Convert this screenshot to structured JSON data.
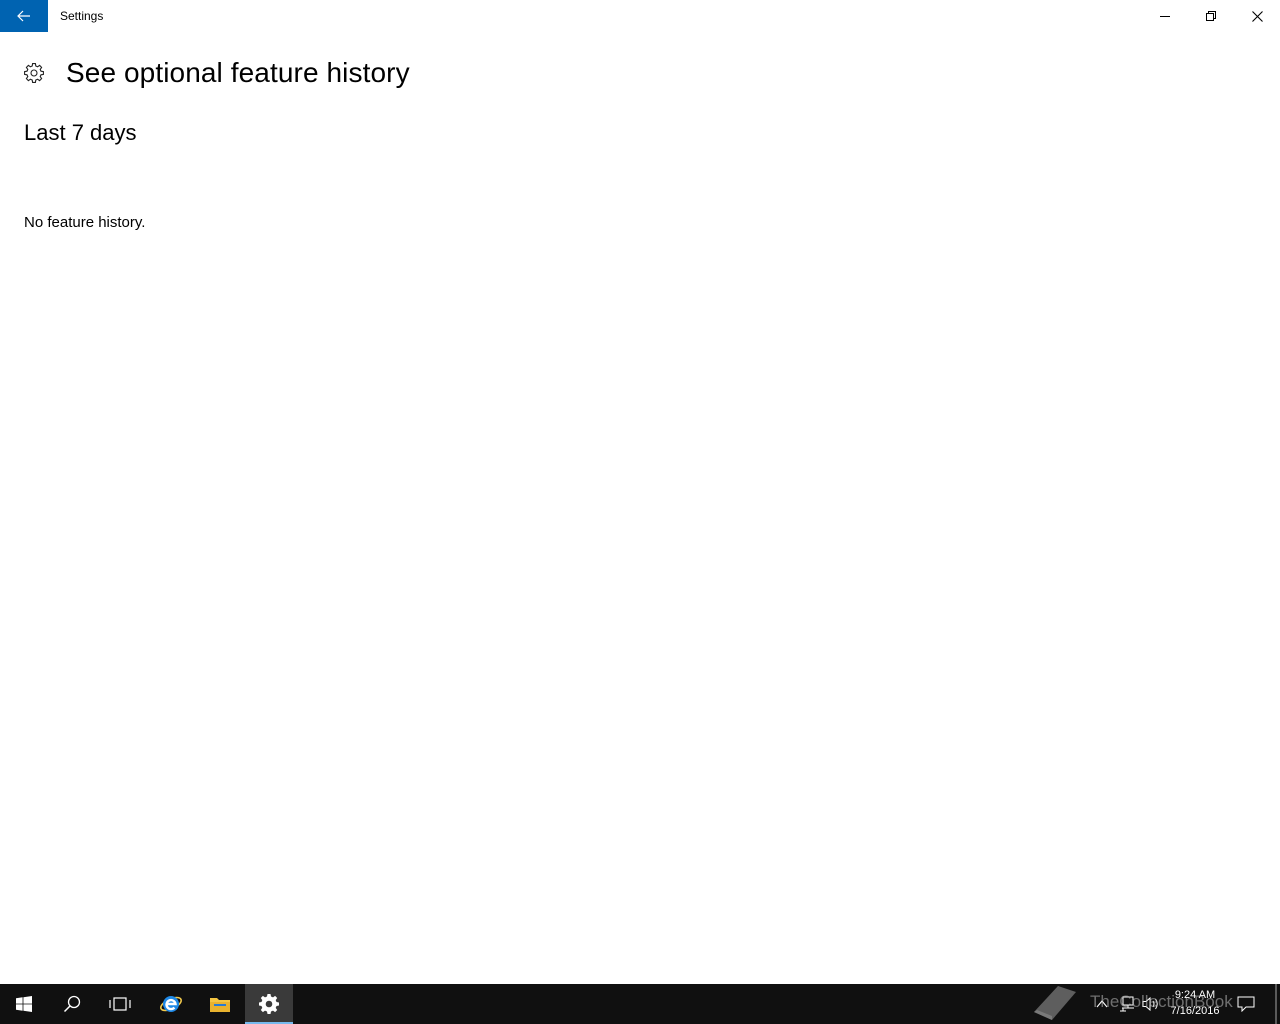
{
  "window": {
    "title": "Settings",
    "accent_color": "#0063b1"
  },
  "icons": {
    "back": "back-arrow-icon",
    "minimize": "minimize-icon",
    "maximize": "restore-icon",
    "close": "close-icon",
    "page": "gear-icon"
  },
  "page": {
    "title": "See optional feature history",
    "section_title": "Last 7 days",
    "empty_message": "No feature history."
  },
  "taskbar": {
    "apps": [
      "start",
      "search",
      "task-view",
      "edge",
      "file-explorer",
      "settings"
    ],
    "active_app": "settings",
    "clock": {
      "time": "9:24 AM",
      "date": "7/16/2016"
    }
  },
  "watermark": {
    "text": "TheCollectionBook"
  }
}
